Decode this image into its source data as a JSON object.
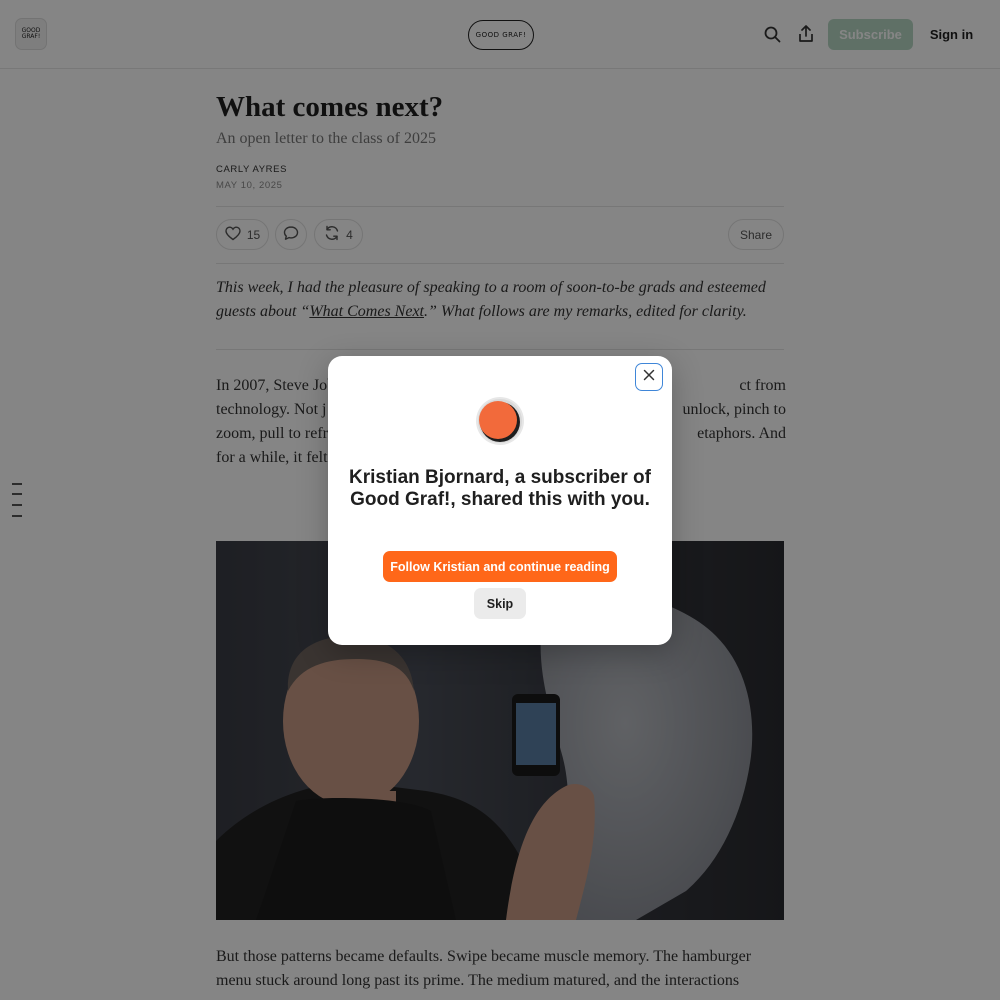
{
  "header": {
    "logo_small_text": "GOOD GRAF!",
    "logo_text": "GOOD GRAF!",
    "subscribe_label": "Subscribe",
    "signin_label": "Sign in"
  },
  "article": {
    "title": "What comes next?",
    "subtitle": "An open letter to the class of 2025",
    "author": "CARLY AYRES",
    "date": "MAY 10, 2025",
    "like_count": "15",
    "restack_count": "4",
    "share_label": "Share",
    "intro_part1": "This week, I had the pleasure of speaking to a room of soon-to-be grads and esteemed guests about “",
    "intro_link": "What Comes Next",
    "intro_part2": ".” What follows are my remarks, edited for clarity.",
    "body1_line1_left": "In 2007, Steve Job",
    "body1_line1_right": "ct from",
    "body1_line2_left": "technology. Not j",
    "body1_line2_right": "unlock, pinch to",
    "body1_line3_left": "zoom, pull to refr",
    "body1_line3_right": "etaphors. And",
    "body1_line4_left": "for a while, it felt",
    "body2": "But those patterns became defaults. Swipe became muscle memory. The hamburger menu stuck around long past its prime. The medium matured, and the interactions"
  },
  "modal": {
    "heading": "Kristian Bjornard, a subscriber of Good Graf!, shared this with you.",
    "follow_label": "Follow Kristian and continue reading",
    "skip_label": "Skip"
  },
  "colors": {
    "accent": "#ff6719",
    "subscribe_bg": "#b7d6c3",
    "focus_ring": "#3f86d8"
  }
}
